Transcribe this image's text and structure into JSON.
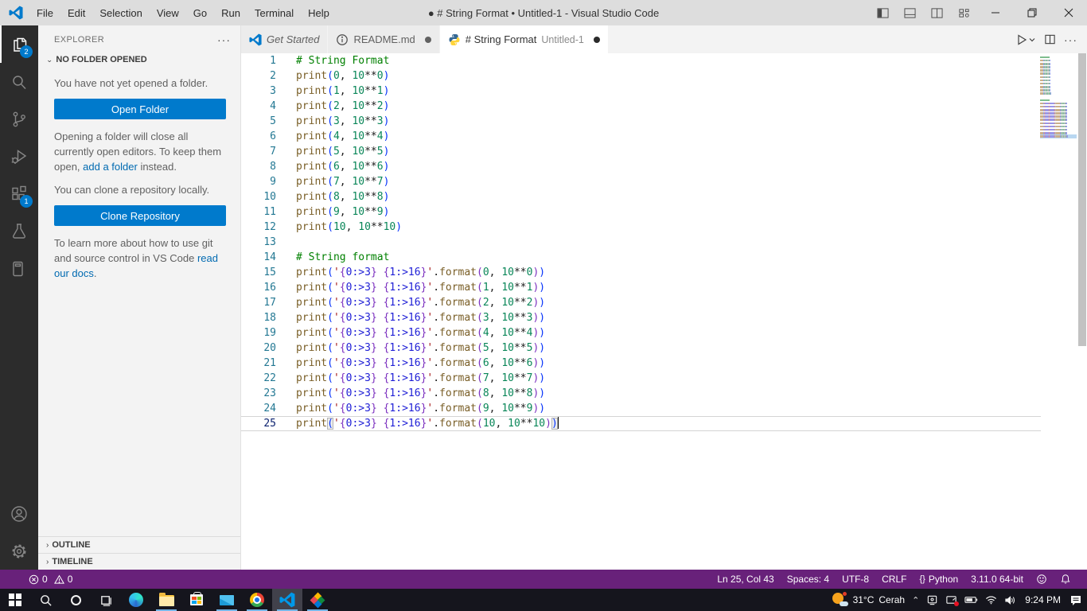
{
  "title_bar": {
    "title": "● # String Format • Untitled-1 - Visual Studio Code",
    "menus": [
      "File",
      "Edit",
      "Selection",
      "View",
      "Go",
      "Run",
      "Terminal",
      "Help"
    ]
  },
  "activity_bar": {
    "explorer_badge": "2",
    "extensions_badge": "1"
  },
  "sidebar": {
    "header": "EXPLORER",
    "section_title": "NO FOLDER OPENED",
    "empty_text": "You have not yet opened a folder.",
    "open_folder_button": "Open Folder",
    "note_pre": "Opening a folder will close all currently open editors. To keep them open, ",
    "note_link": "add a folder",
    "note_post": " instead.",
    "clone_text": "You can clone a repository locally.",
    "clone_button": "Clone Repository",
    "git_pre": "To learn more about how to use git and source control in VS Code ",
    "git_link": "read our docs",
    "git_post": ".",
    "outline_label": "OUTLINE",
    "timeline_label": "TIMELINE"
  },
  "tabs": {
    "tab1": {
      "label": "Get Started"
    },
    "tab2": {
      "label": "README.md"
    },
    "tab3": {
      "label": "# String Format",
      "sublabel": "Untitled-1"
    }
  },
  "editor": {
    "active_line": 25,
    "lines": [
      [
        [
          "c",
          "# String Format"
        ]
      ],
      [
        [
          "f",
          "print"
        ],
        [
          "b1",
          "("
        ],
        [
          "n",
          "0"
        ],
        [
          "o",
          ", "
        ],
        [
          "n",
          "10"
        ],
        [
          "o",
          "**"
        ],
        [
          "n",
          "0"
        ],
        [
          "b1",
          ")"
        ]
      ],
      [
        [
          "f",
          "print"
        ],
        [
          "b1",
          "("
        ],
        [
          "n",
          "1"
        ],
        [
          "o",
          ", "
        ],
        [
          "n",
          "10"
        ],
        [
          "o",
          "**"
        ],
        [
          "n",
          "1"
        ],
        [
          "b1",
          ")"
        ]
      ],
      [
        [
          "f",
          "print"
        ],
        [
          "b1",
          "("
        ],
        [
          "n",
          "2"
        ],
        [
          "o",
          ", "
        ],
        [
          "n",
          "10"
        ],
        [
          "o",
          "**"
        ],
        [
          "n",
          "2"
        ],
        [
          "b1",
          ")"
        ]
      ],
      [
        [
          "f",
          "print"
        ],
        [
          "b1",
          "("
        ],
        [
          "n",
          "3"
        ],
        [
          "o",
          ", "
        ],
        [
          "n",
          "10"
        ],
        [
          "o",
          "**"
        ],
        [
          "n",
          "3"
        ],
        [
          "b1",
          ")"
        ]
      ],
      [
        [
          "f",
          "print"
        ],
        [
          "b1",
          "("
        ],
        [
          "n",
          "4"
        ],
        [
          "o",
          ", "
        ],
        [
          "n",
          "10"
        ],
        [
          "o",
          "**"
        ],
        [
          "n",
          "4"
        ],
        [
          "b1",
          ")"
        ]
      ],
      [
        [
          "f",
          "print"
        ],
        [
          "b1",
          "("
        ],
        [
          "n",
          "5"
        ],
        [
          "o",
          ", "
        ],
        [
          "n",
          "10"
        ],
        [
          "o",
          "**"
        ],
        [
          "n",
          "5"
        ],
        [
          "b1",
          ")"
        ]
      ],
      [
        [
          "f",
          "print"
        ],
        [
          "b1",
          "("
        ],
        [
          "n",
          "6"
        ],
        [
          "o",
          ", "
        ],
        [
          "n",
          "10"
        ],
        [
          "o",
          "**"
        ],
        [
          "n",
          "6"
        ],
        [
          "b1",
          ")"
        ]
      ],
      [
        [
          "f",
          "print"
        ],
        [
          "b1",
          "("
        ],
        [
          "n",
          "7"
        ],
        [
          "o",
          ", "
        ],
        [
          "n",
          "10"
        ],
        [
          "o",
          "**"
        ],
        [
          "n",
          "7"
        ],
        [
          "b1",
          ")"
        ]
      ],
      [
        [
          "f",
          "print"
        ],
        [
          "b1",
          "("
        ],
        [
          "n",
          "8"
        ],
        [
          "o",
          ", "
        ],
        [
          "n",
          "10"
        ],
        [
          "o",
          "**"
        ],
        [
          "n",
          "8"
        ],
        [
          "b1",
          ")"
        ]
      ],
      [
        [
          "f",
          "print"
        ],
        [
          "b1",
          "("
        ],
        [
          "n",
          "9"
        ],
        [
          "o",
          ", "
        ],
        [
          "n",
          "10"
        ],
        [
          "o",
          "**"
        ],
        [
          "n",
          "9"
        ],
        [
          "b1",
          ")"
        ]
      ],
      [
        [
          "f",
          "print"
        ],
        [
          "b1",
          "("
        ],
        [
          "n",
          "10"
        ],
        [
          "o",
          ", "
        ],
        [
          "n",
          "10"
        ],
        [
          "o",
          "**"
        ],
        [
          "n",
          "10"
        ],
        [
          "b1",
          ")"
        ]
      ],
      [],
      [
        [
          "c",
          "# String format"
        ]
      ],
      [
        [
          "f",
          "print"
        ],
        [
          "b1",
          "("
        ],
        [
          "s",
          "'"
        ],
        [
          "pb",
          "{"
        ],
        [
          "pc",
          "0:>3"
        ],
        [
          "pb",
          "}"
        ],
        [
          "s",
          " "
        ],
        [
          "pb",
          "{"
        ],
        [
          "pc",
          "1:>16"
        ],
        [
          "pb",
          "}"
        ],
        [
          "s",
          "'"
        ],
        [
          "o",
          "."
        ],
        [
          "f",
          "format"
        ],
        [
          "b2",
          "("
        ],
        [
          "n",
          "0"
        ],
        [
          "o",
          ", "
        ],
        [
          "n",
          "10"
        ],
        [
          "o",
          "**"
        ],
        [
          "n",
          "0"
        ],
        [
          "b2",
          ")"
        ],
        [
          "b1",
          ")"
        ]
      ],
      [
        [
          "f",
          "print"
        ],
        [
          "b1",
          "("
        ],
        [
          "s",
          "'"
        ],
        [
          "pb",
          "{"
        ],
        [
          "pc",
          "0:>3"
        ],
        [
          "pb",
          "}"
        ],
        [
          "s",
          " "
        ],
        [
          "pb",
          "{"
        ],
        [
          "pc",
          "1:>16"
        ],
        [
          "pb",
          "}"
        ],
        [
          "s",
          "'"
        ],
        [
          "o",
          "."
        ],
        [
          "f",
          "format"
        ],
        [
          "b2",
          "("
        ],
        [
          "n",
          "1"
        ],
        [
          "o",
          ", "
        ],
        [
          "n",
          "10"
        ],
        [
          "o",
          "**"
        ],
        [
          "n",
          "1"
        ],
        [
          "b2",
          ")"
        ],
        [
          "b1",
          ")"
        ]
      ],
      [
        [
          "f",
          "print"
        ],
        [
          "b1",
          "("
        ],
        [
          "s",
          "'"
        ],
        [
          "pb",
          "{"
        ],
        [
          "pc",
          "0:>3"
        ],
        [
          "pb",
          "}"
        ],
        [
          "s",
          " "
        ],
        [
          "pb",
          "{"
        ],
        [
          "pc",
          "1:>16"
        ],
        [
          "pb",
          "}"
        ],
        [
          "s",
          "'"
        ],
        [
          "o",
          "."
        ],
        [
          "f",
          "format"
        ],
        [
          "b2",
          "("
        ],
        [
          "n",
          "2"
        ],
        [
          "o",
          ", "
        ],
        [
          "n",
          "10"
        ],
        [
          "o",
          "**"
        ],
        [
          "n",
          "2"
        ],
        [
          "b2",
          ")"
        ],
        [
          "b1",
          ")"
        ]
      ],
      [
        [
          "f",
          "print"
        ],
        [
          "b1",
          "("
        ],
        [
          "s",
          "'"
        ],
        [
          "pb",
          "{"
        ],
        [
          "pc",
          "0:>3"
        ],
        [
          "pb",
          "}"
        ],
        [
          "s",
          " "
        ],
        [
          "pb",
          "{"
        ],
        [
          "pc",
          "1:>16"
        ],
        [
          "pb",
          "}"
        ],
        [
          "s",
          "'"
        ],
        [
          "o",
          "."
        ],
        [
          "f",
          "format"
        ],
        [
          "b2",
          "("
        ],
        [
          "n",
          "3"
        ],
        [
          "o",
          ", "
        ],
        [
          "n",
          "10"
        ],
        [
          "o",
          "**"
        ],
        [
          "n",
          "3"
        ],
        [
          "b2",
          ")"
        ],
        [
          "b1",
          ")"
        ]
      ],
      [
        [
          "f",
          "print"
        ],
        [
          "b1",
          "("
        ],
        [
          "s",
          "'"
        ],
        [
          "pb",
          "{"
        ],
        [
          "pc",
          "0:>3"
        ],
        [
          "pb",
          "}"
        ],
        [
          "s",
          " "
        ],
        [
          "pb",
          "{"
        ],
        [
          "pc",
          "1:>16"
        ],
        [
          "pb",
          "}"
        ],
        [
          "s",
          "'"
        ],
        [
          "o",
          "."
        ],
        [
          "f",
          "format"
        ],
        [
          "b2",
          "("
        ],
        [
          "n",
          "4"
        ],
        [
          "o",
          ", "
        ],
        [
          "n",
          "10"
        ],
        [
          "o",
          "**"
        ],
        [
          "n",
          "4"
        ],
        [
          "b2",
          ")"
        ],
        [
          "b1",
          ")"
        ]
      ],
      [
        [
          "f",
          "print"
        ],
        [
          "b1",
          "("
        ],
        [
          "s",
          "'"
        ],
        [
          "pb",
          "{"
        ],
        [
          "pc",
          "0:>3"
        ],
        [
          "pb",
          "}"
        ],
        [
          "s",
          " "
        ],
        [
          "pb",
          "{"
        ],
        [
          "pc",
          "1:>16"
        ],
        [
          "pb",
          "}"
        ],
        [
          "s",
          "'"
        ],
        [
          "o",
          "."
        ],
        [
          "f",
          "format"
        ],
        [
          "b2",
          "("
        ],
        [
          "n",
          "5"
        ],
        [
          "o",
          ", "
        ],
        [
          "n",
          "10"
        ],
        [
          "o",
          "**"
        ],
        [
          "n",
          "5"
        ],
        [
          "b2",
          ")"
        ],
        [
          "b1",
          ")"
        ]
      ],
      [
        [
          "f",
          "print"
        ],
        [
          "b1",
          "("
        ],
        [
          "s",
          "'"
        ],
        [
          "pb",
          "{"
        ],
        [
          "pc",
          "0:>3"
        ],
        [
          "pb",
          "}"
        ],
        [
          "s",
          " "
        ],
        [
          "pb",
          "{"
        ],
        [
          "pc",
          "1:>16"
        ],
        [
          "pb",
          "}"
        ],
        [
          "s",
          "'"
        ],
        [
          "o",
          "."
        ],
        [
          "f",
          "format"
        ],
        [
          "b2",
          "("
        ],
        [
          "n",
          "6"
        ],
        [
          "o",
          ", "
        ],
        [
          "n",
          "10"
        ],
        [
          "o",
          "**"
        ],
        [
          "n",
          "6"
        ],
        [
          "b2",
          ")"
        ],
        [
          "b1",
          ")"
        ]
      ],
      [
        [
          "f",
          "print"
        ],
        [
          "b1",
          "("
        ],
        [
          "s",
          "'"
        ],
        [
          "pb",
          "{"
        ],
        [
          "pc",
          "0:>3"
        ],
        [
          "pb",
          "}"
        ],
        [
          "s",
          " "
        ],
        [
          "pb",
          "{"
        ],
        [
          "pc",
          "1:>16"
        ],
        [
          "pb",
          "}"
        ],
        [
          "s",
          "'"
        ],
        [
          "o",
          "."
        ],
        [
          "f",
          "format"
        ],
        [
          "b2",
          "("
        ],
        [
          "n",
          "7"
        ],
        [
          "o",
          ", "
        ],
        [
          "n",
          "10"
        ],
        [
          "o",
          "**"
        ],
        [
          "n",
          "7"
        ],
        [
          "b2",
          ")"
        ],
        [
          "b1",
          ")"
        ]
      ],
      [
        [
          "f",
          "print"
        ],
        [
          "b1",
          "("
        ],
        [
          "s",
          "'"
        ],
        [
          "pb",
          "{"
        ],
        [
          "pc",
          "0:>3"
        ],
        [
          "pb",
          "}"
        ],
        [
          "s",
          " "
        ],
        [
          "pb",
          "{"
        ],
        [
          "pc",
          "1:>16"
        ],
        [
          "pb",
          "}"
        ],
        [
          "s",
          "'"
        ],
        [
          "o",
          "."
        ],
        [
          "f",
          "format"
        ],
        [
          "b2",
          "("
        ],
        [
          "n",
          "8"
        ],
        [
          "o",
          ", "
        ],
        [
          "n",
          "10"
        ],
        [
          "o",
          "**"
        ],
        [
          "n",
          "8"
        ],
        [
          "b2",
          ")"
        ],
        [
          "b1",
          ")"
        ]
      ],
      [
        [
          "f",
          "print"
        ],
        [
          "b1",
          "("
        ],
        [
          "s",
          "'"
        ],
        [
          "pb",
          "{"
        ],
        [
          "pc",
          "0:>3"
        ],
        [
          "pb",
          "}"
        ],
        [
          "s",
          " "
        ],
        [
          "pb",
          "{"
        ],
        [
          "pc",
          "1:>16"
        ],
        [
          "pb",
          "}"
        ],
        [
          "s",
          "'"
        ],
        [
          "o",
          "."
        ],
        [
          "f",
          "format"
        ],
        [
          "b2",
          "("
        ],
        [
          "n",
          "9"
        ],
        [
          "o",
          ", "
        ],
        [
          "n",
          "10"
        ],
        [
          "o",
          "**"
        ],
        [
          "n",
          "9"
        ],
        [
          "b2",
          ")"
        ],
        [
          "b1",
          ")"
        ]
      ],
      [
        [
          "f",
          "print"
        ],
        [
          "b1 m",
          "("
        ],
        [
          "s",
          "'"
        ],
        [
          "pb",
          "{"
        ],
        [
          "pc",
          "0:>3"
        ],
        [
          "pb",
          "}"
        ],
        [
          "s",
          " "
        ],
        [
          "pb",
          "{"
        ],
        [
          "pc",
          "1:>16"
        ],
        [
          "pb",
          "}"
        ],
        [
          "s",
          "'"
        ],
        [
          "o",
          "."
        ],
        [
          "f",
          "format"
        ],
        [
          "b2",
          "("
        ],
        [
          "n",
          "10"
        ],
        [
          "o",
          ", "
        ],
        [
          "n",
          "10"
        ],
        [
          "o",
          "**"
        ],
        [
          "n",
          "10"
        ],
        [
          "b2",
          ")"
        ],
        [
          "b1 m",
          ")"
        ],
        [
          "caret",
          ""
        ]
      ]
    ]
  },
  "status_bar": {
    "errors": "0",
    "warnings": "0",
    "cursor": "Ln 25, Col 43",
    "indent": "Spaces: 4",
    "encoding": "UTF-8",
    "eol": "CRLF",
    "braces": "{}",
    "language": "Python",
    "interpreter": "3.11.0 64-bit",
    "bg": "#68217A"
  },
  "taskbar": {
    "weather_temp": "31°C",
    "weather_desc": "Cerah",
    "time": "9:24 PM"
  }
}
